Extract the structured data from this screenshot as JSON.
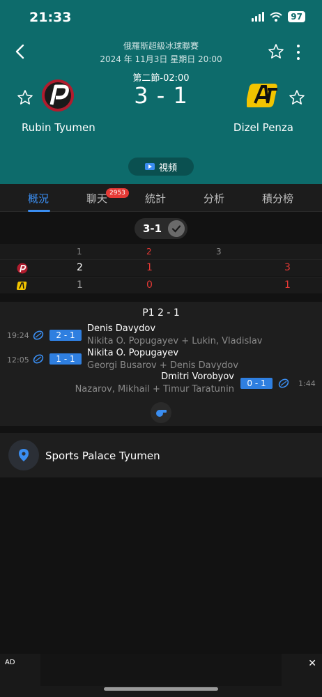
{
  "status_bar": {
    "time": "21:33",
    "battery": "97"
  },
  "header": {
    "league": "俄羅斯超級冰球聯賽",
    "datetime": "2024 年 11月3日 星期日 20:00",
    "period_info": "第二節-02:00",
    "score": "3 - 1",
    "home_team": "Rubin Tyumen",
    "away_team": "Dizel Penza",
    "video_label": "視頻"
  },
  "tabs": [
    {
      "label": "概況",
      "active": true
    },
    {
      "label": "聊天",
      "badge": "2953"
    },
    {
      "label": "統計"
    },
    {
      "label": "分析"
    },
    {
      "label": "積分榜"
    }
  ],
  "score_table": {
    "pill_score": "3-1",
    "periods": [
      "1",
      "2",
      "3"
    ],
    "home": {
      "p1": "2",
      "p2": "1",
      "total": "3"
    },
    "away": {
      "p1": "1",
      "p2": "0",
      "total": "1"
    }
  },
  "events": {
    "period_title": "P1 2 - 1",
    "items": [
      {
        "time": "19:24",
        "score": "2 - 1",
        "scorer": "Denis Davydov",
        "assists": "Nikita O. Popugayev + Lukin, Vladislav",
        "side": "home"
      },
      {
        "time": "12:05",
        "score": "1 - 1",
        "scorer": "Nikita O. Popugayev",
        "assists": "Georgi Busarov + Denis Davydov",
        "side": "home"
      },
      {
        "time": "1:44",
        "score": "0 - 1",
        "scorer": "Dmitri Vorobyov",
        "assists": "Nazarov, Mikhail + Timur Taratunin",
        "side": "away"
      }
    ]
  },
  "venue": {
    "name": "Sports Palace Tyumen"
  },
  "ad": {
    "label": "AD",
    "close": "✕"
  },
  "colors": {
    "header_bg": "#0d6b6b",
    "accent": "#3a8df0",
    "highlight_red": "#e53935",
    "home_logo_red": "#b01c2e",
    "away_logo_yellow": "#f2c400"
  }
}
